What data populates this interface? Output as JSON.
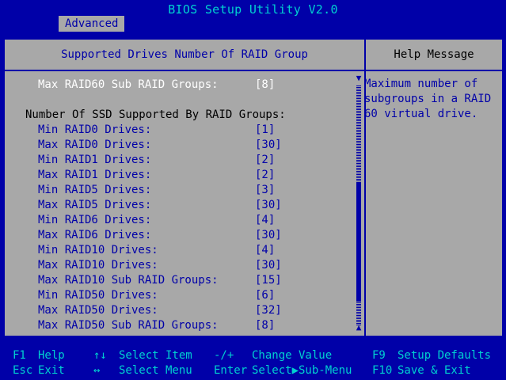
{
  "title": "BIOS Setup Utility V2.0",
  "tab": "Advanced",
  "header": {
    "left": "Supported Drives Number Of RAID Group",
    "right": "Help Message"
  },
  "rows": [
    {
      "label": "Max RAID60 Sub RAID Groups:",
      "value": "[8]",
      "type": "item",
      "highlight": true
    },
    {
      "label": "",
      "value": "",
      "type": "blank"
    },
    {
      "label": "Number Of SSD Supported By RAID Groups:",
      "value": "",
      "type": "header"
    },
    {
      "label": "Min RAID0 Drives:",
      "value": "[1]",
      "type": "item"
    },
    {
      "label": "Max RAID0 Drives:",
      "value": "[30]",
      "type": "item"
    },
    {
      "label": "Min RAID1 Drives:",
      "value": "[2]",
      "type": "item"
    },
    {
      "label": "Max RAID1 Drives:",
      "value": "[2]",
      "type": "item"
    },
    {
      "label": "Min RAID5 Drives:",
      "value": "[3]",
      "type": "item"
    },
    {
      "label": "Max RAID5 Drives:",
      "value": "[30]",
      "type": "item"
    },
    {
      "label": "Min RAID6 Drives:",
      "value": "[4]",
      "type": "item"
    },
    {
      "label": "Max RAID6 Drives:",
      "value": "[30]",
      "type": "item"
    },
    {
      "label": "Min RAID10 Drives:",
      "value": "[4]",
      "type": "item"
    },
    {
      "label": "Max RAID10 Drives:",
      "value": "[30]",
      "type": "item"
    },
    {
      "label": "Max RAID10 Sub RAID Groups:",
      "value": "[15]",
      "type": "item"
    },
    {
      "label": "Min RAID50 Drives:",
      "value": "[6]",
      "type": "item"
    },
    {
      "label": "Max RAID50 Drives:",
      "value": "[32]",
      "type": "item"
    },
    {
      "label": "Max RAID50 Sub RAID Groups:",
      "value": "[8]",
      "type": "item"
    }
  ],
  "help": "Maximum number of\nsubgroups in a RAID\n60 virtual drive.",
  "scrollbar": {
    "up": "▼",
    "down": "▲"
  },
  "footer": [
    {
      "key": "F1",
      "desc": "Help"
    },
    {
      "key": "Esc",
      "desc": "Exit"
    },
    {
      "key": "↑↓",
      "desc": "Select Item"
    },
    {
      "key": "↔",
      "desc": "Select Menu"
    },
    {
      "key": "-/+",
      "desc": "Change Value"
    },
    {
      "key": "Enter",
      "desc": "Select▶Sub-Menu"
    },
    {
      "key": "F9",
      "desc": "Setup Defaults"
    },
    {
      "key": "F10",
      "desc": "Save & Exit"
    }
  ],
  "colors": {
    "background": "#0000a8",
    "panel": "#a8a8a8",
    "accent": "#00d0d0",
    "highlight_text": "#ffffff"
  }
}
